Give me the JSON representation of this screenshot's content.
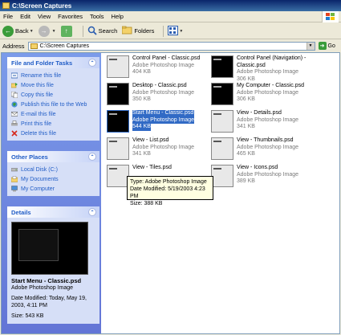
{
  "window": {
    "title": "C:\\Screen Captures"
  },
  "menu": [
    "File",
    "Edit",
    "View",
    "Favorites",
    "Tools",
    "Help"
  ],
  "toolbar": {
    "back": "Back",
    "search": "Search",
    "folders": "Folders"
  },
  "address": {
    "label": "Address",
    "value": "C:\\Screen Captures",
    "go": "Go"
  },
  "tasks": {
    "title": "File and Folder Tasks",
    "items": [
      "Rename this file",
      "Move this file",
      "Copy this file",
      "Publish this file to the Web",
      "E-mail this file",
      "Print this file",
      "Delete this file"
    ]
  },
  "places": {
    "title": "Other Places",
    "items": [
      "Local Disk (C:)",
      "My Documents",
      "My Computer"
    ]
  },
  "details": {
    "title": "Details",
    "name": "Start Menu - Classic.psd",
    "type": "Adobe Photoshop Image",
    "modified_line1": "Date Modified: Today, May 19,",
    "modified_line2": "2003, 4:11 PM",
    "size": "Size: 543 KB"
  },
  "files": [
    {
      "name": "Control Panel - Classic.psd",
      "name2": "",
      "type": "Adobe Photoshop Image",
      "size": "404 KB",
      "selected": false
    },
    {
      "name": "Control Panel (Navigation) -",
      "name2": "Classic.psd",
      "type": "Adobe Photoshop Image",
      "size": "306 KB",
      "selected": false
    },
    {
      "name": "Desktop - Classic.psd",
      "name2": "",
      "type": "Adobe Photoshop Image",
      "size": "350 KB",
      "selected": false
    },
    {
      "name": "My Computer - Classic.psd",
      "name2": "",
      "type": "Adobe Photoshop Image",
      "size": "306 KB",
      "selected": false
    },
    {
      "name": "Start Menu - Classic.psd",
      "name2": "",
      "type": "Adobe Photoshop Image",
      "size": "544 KB",
      "selected": true
    },
    {
      "name": "View - Details.psd",
      "name2": "",
      "type": "Adobe Photoshop Image",
      "size": "341 KB",
      "selected": false
    },
    {
      "name": "View - List.psd",
      "name2": "",
      "type": "Adobe Photoshop Image",
      "size": "341 KB",
      "selected": false
    },
    {
      "name": "View - Thumbnails.psd",
      "name2": "",
      "type": "Adobe Photoshop Image",
      "size": "465 KB",
      "selected": false
    },
    {
      "name": "View - Tiles.psd",
      "name2": "",
      "type": "",
      "size": "",
      "selected": false
    },
    {
      "name": "View - Icons.psd",
      "name2": "",
      "type": "Adobe Photoshop Image",
      "size": "389 KB",
      "selected": false
    }
  ],
  "tooltip": {
    "type": "Type: Adobe Photoshop Image",
    "modified": "Date Modified: 5/19/2003 4:23 PM",
    "size": "Size: 388 KB"
  }
}
